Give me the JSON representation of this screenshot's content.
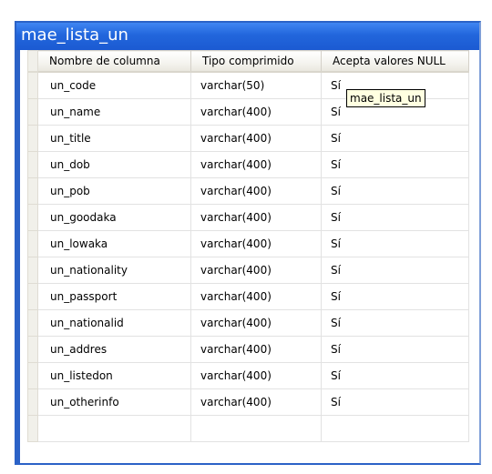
{
  "window": {
    "title": "mae_lista_un"
  },
  "columns_header": {
    "name": "Nombre de columna",
    "type": "Tipo comprimido",
    "nullable": "Acepta valores NULL"
  },
  "rows": [
    {
      "name": "un_code",
      "type": "varchar(50)",
      "nullable": "Sí"
    },
    {
      "name": "un_name",
      "type": "varchar(400)",
      "nullable": "Sí"
    },
    {
      "name": "un_title",
      "type": "varchar(400)",
      "nullable": "Sí"
    },
    {
      "name": "un_dob",
      "type": "varchar(400)",
      "nullable": "Sí"
    },
    {
      "name": "un_pob",
      "type": "varchar(400)",
      "nullable": "Sí"
    },
    {
      "name": "un_goodaka",
      "type": "varchar(400)",
      "nullable": "Sí"
    },
    {
      "name": "un_lowaka",
      "type": "varchar(400)",
      "nullable": "Sí"
    },
    {
      "name": "un_nationality",
      "type": "varchar(400)",
      "nullable": "Sí"
    },
    {
      "name": "un_passport",
      "type": "varchar(400)",
      "nullable": "Sí"
    },
    {
      "name": "un_nationalid",
      "type": "varchar(400)",
      "nullable": "Sí"
    },
    {
      "name": "un_addres",
      "type": "varchar(400)",
      "nullable": "Sí"
    },
    {
      "name": "un_listedon",
      "type": "varchar(400)",
      "nullable": "Sí"
    },
    {
      "name": "un_otherinfo",
      "type": "varchar(400)",
      "nullable": "Sí"
    },
    {
      "name": "",
      "type": "",
      "nullable": ""
    }
  ],
  "tooltip": {
    "text": "mae_lista_un"
  },
  "colors": {
    "title_bar": "#2266dc",
    "title_text": "#ffffff",
    "tooltip_bg": "#ffffe1"
  }
}
